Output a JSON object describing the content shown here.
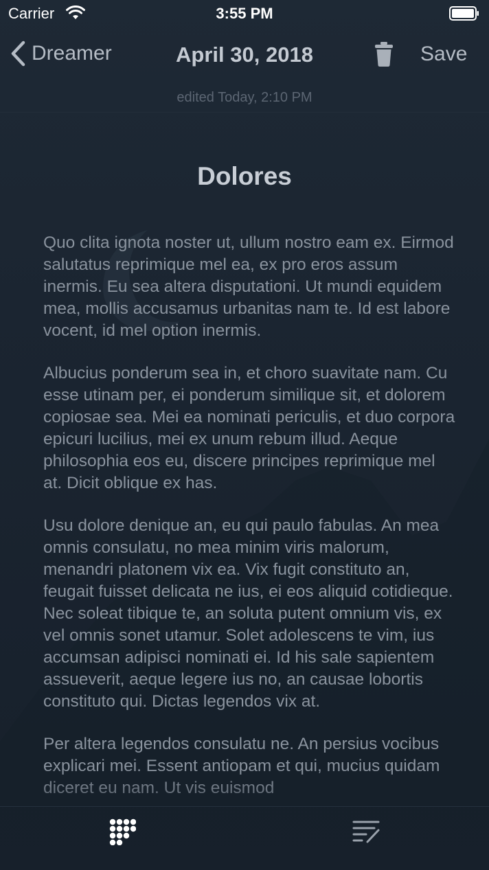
{
  "status_bar": {
    "carrier": "Carrier",
    "time": "3:55 PM"
  },
  "nav": {
    "back_label": "Dreamer",
    "title": "April 30, 2018",
    "save_label": "Save",
    "edited": "edited Today, 2:10 PM"
  },
  "note": {
    "title": "Dolores",
    "paragraphs": [
      "Quo clita ignota noster ut, ullum nostro eam ex. Eirmod salutatus reprimique mel ea, ex pro eros assum inermis. Eu sea altera disputationi. Ut mundi equidem mea, mollis accusamus urbanitas nam te. Id est labore vocent, id mel option inermis.",
      "Albucius ponderum sea in, et choro suavitate nam. Cu esse utinam per, ei ponderum similique sit, et dolorem copiosae sea. Mei ea nominati periculis, et duo corpora epicuri lucilius, mei ex unum rebum illud. Aeque philosophia eos eu, discere principes reprimique mel at. Dicit oblique ex has.",
      "Usu dolore denique an, eu qui paulo fabulas. An mea omnis consulatu, no mea minim viris malorum, menandri platonem vix ea. Vix fugit constituto an, feugait fuisset delicata ne ius, ei eos aliquid cotidieque. Nec soleat tibique te, an soluta putent omnium vis, ex vel omnis sonet utamur. Solet adolescens te vim, ius accumsan adipisci nominati ei. Id his sale sapientem assueverit, aeque legere ius no, an causae lobortis constituto qui. Dictas legendos vix at.",
      "Per altera legendos consulatu ne. An persius vocibus explicari mei. Essent antiopam et qui, mucius quidam diceret eu nam. Ut vis euismod"
    ]
  },
  "toolbar": {
    "left_icon": "grid-icon",
    "right_icon": "format-text-icon"
  },
  "colors": {
    "background": "#1b2531",
    "text": "#8a939e",
    "title": "#c8ced6"
  }
}
